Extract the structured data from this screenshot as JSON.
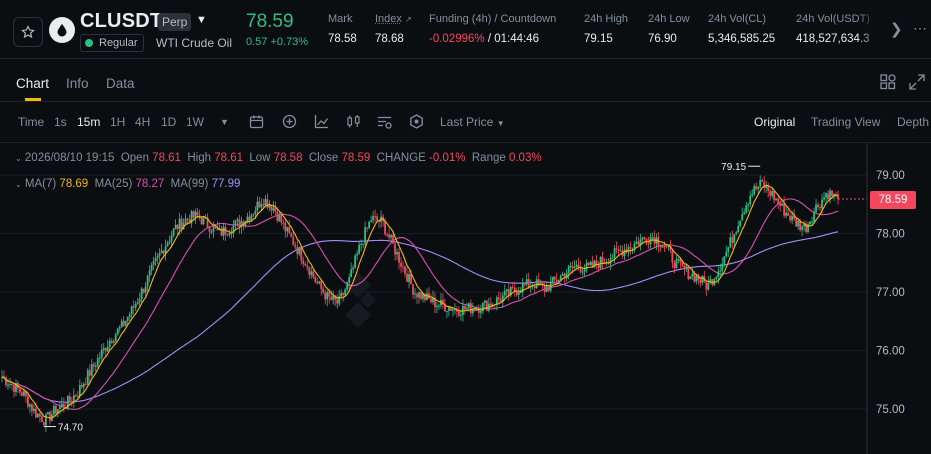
{
  "header": {
    "symbol": "CLUSDT",
    "contract_type": "Perp",
    "tag": "Regular",
    "underlying": "WTI Crude Oil",
    "last_price": "78.59",
    "change": "0.57 +0.73%",
    "stats": [
      {
        "label": "Mark",
        "value": "78.58"
      },
      {
        "label": "Index",
        "value": "78.68"
      },
      {
        "label": "Funding (4h) / Countdown",
        "value_red": "-0.02996%",
        "value_rest": " / 01:44:46"
      },
      {
        "label": "24h High",
        "value": "79.15"
      },
      {
        "label": "24h Low",
        "value": "76.90"
      },
      {
        "label": "24h Vol(CL)",
        "value": "5,346,585.25"
      },
      {
        "label": "24h Vol(USDT)",
        "value": "418,527,634.3"
      }
    ],
    "icons": {
      "star": "star-icon",
      "logo": "oil-drop-icon",
      "dropdown": "caret-down-icon",
      "next": "chevron-right-icon",
      "more": "more-icon"
    }
  },
  "tabs": [
    "Chart",
    "Info",
    "Data"
  ],
  "toolbar": {
    "time_label": "Time",
    "intervals": [
      "1s",
      "15m",
      "1H",
      "4H",
      "1D",
      "1W"
    ],
    "active_interval": "15m",
    "price_type": "Last Price",
    "views": [
      "Original",
      "Trading View",
      "Depth"
    ],
    "active_view": "Original"
  },
  "ohlc": {
    "date": "2026/08/10 19:15",
    "open_label": "Open",
    "open": "78.61",
    "high_label": "High",
    "high": "78.61",
    "low_label": "Low",
    "low": "78.58",
    "close_label": "Close",
    "close": "78.59",
    "change_label": "CHANGE",
    "change": "-0.01%",
    "range_label": "Range",
    "range": "0.03%"
  },
  "ma": {
    "ma7_label": "MA(7)",
    "ma7": "78.69",
    "ma25_label": "MA(25)",
    "ma25": "78.27",
    "ma99_label": "MA(99)",
    "ma99": "77.99"
  },
  "chart_data": {
    "type": "candlestick",
    "y_ticks": [
      "79.00",
      "78.00",
      "77.00",
      "76.00",
      "75.00"
    ],
    "ylim": [
      74.5,
      79.45
    ],
    "current_price": "78.59",
    "high_marker": "79.15",
    "low_marker": "74.70",
    "closes": [
      75.55,
      75.4,
      75.25,
      74.95,
      74.8,
      75.0,
      75.1,
      75.3,
      75.6,
      75.9,
      76.2,
      76.4,
      76.7,
      77.05,
      77.45,
      77.8,
      78.1,
      78.25,
      78.3,
      78.15,
      78.0,
      78.1,
      78.2,
      78.35,
      78.6,
      78.45,
      78.1,
      77.8,
      77.5,
      77.15,
      76.9,
      76.8,
      77.2,
      77.8,
      78.25,
      78.2,
      77.8,
      77.4,
      77.0,
      76.9,
      76.8,
      76.75,
      76.7,
      76.72,
      76.75,
      76.8,
      76.9,
      77.0,
      77.1,
      77.15,
      77.05,
      77.2,
      77.35,
      77.45,
      77.4,
      77.5,
      77.6,
      77.7,
      77.8,
      77.9,
      77.95,
      77.8,
      77.5,
      77.35,
      77.25,
      77.1,
      77.4,
      77.8,
      78.3,
      78.7,
      78.85,
      78.65,
      78.4,
      78.2,
      78.1,
      78.45,
      78.7,
      78.59
    ],
    "colors": {
      "up": "#2ebd85",
      "down": "#f6465d",
      "ma7": "#f0b90b",
      "ma25": "#d84fb1",
      "ma99": "#a78bfa",
      "accent": "#f0b90b"
    }
  }
}
